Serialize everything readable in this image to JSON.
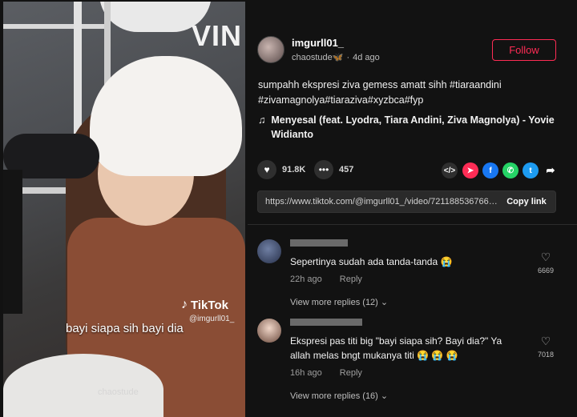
{
  "video": {
    "top_watermark": "VIN",
    "tiktok_brand": "TikTok",
    "tiktok_user": "@imgurll01_",
    "caption": "bayi siapa sih bayi dia",
    "ghost_text": "chaostude"
  },
  "post": {
    "username": "imgurll01_",
    "nickname": "chaostude🦋",
    "age": "4d ago",
    "follow_label": "Follow",
    "description": "sumpahh ekspresi ziva gemess amatt sihh #tiaraandini #zivamagnolya#tiaraziva#xyzbca#fyp",
    "music": "Menyesal (feat. Lyodra, Tiara Andini, Ziva Magnolya) - Yovie Widianto",
    "likes": "91.8K",
    "comments": "457",
    "link": "https://www.tiktok.com/@imgurll01_/video/7211885367660...",
    "copy_label": "Copy link"
  },
  "comments": [
    {
      "text": "Sepertinya sudah ada tanda-tanda 😭",
      "time": "22h ago",
      "reply_label": "Reply",
      "likes": "6669",
      "view_more": "View more replies (12) ⌄"
    },
    {
      "text": "Ekspresi pas titi big \"bayi siapa sih? Bayi dia?\" Ya allah melas bngt mukanya titi 😭 😭 😭",
      "time": "16h ago",
      "reply_label": "Reply",
      "likes": "7018",
      "view_more": "View more replies (16) ⌄"
    }
  ],
  "colors": {
    "accent": "#fe2c55",
    "background": "#121212"
  },
  "icons": {
    "like": "heart-icon",
    "comment": "comment-icon",
    "embed": "embed-icon",
    "send": "send-icon",
    "facebook": "facebook-icon",
    "whatsapp": "whatsapp-icon",
    "twitter": "twitter-icon",
    "share": "share-arrow-icon"
  }
}
